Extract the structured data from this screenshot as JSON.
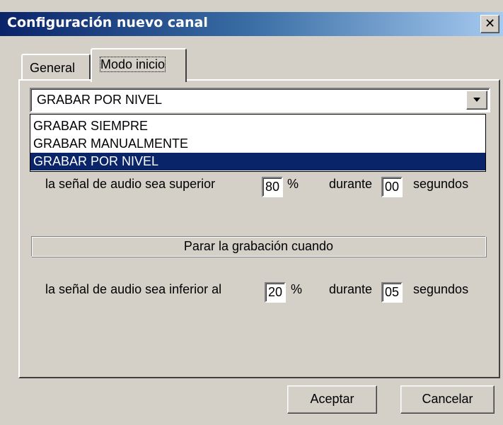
{
  "window": {
    "title": "Configuración nuevo canal",
    "close_glyph": "✕"
  },
  "tabs": [
    {
      "label": "General",
      "active": false
    },
    {
      "label": "Modo inicio",
      "active": true
    }
  ],
  "mode_select": {
    "value": "GRABAR POR NIVEL",
    "options": [
      "GRABAR SIEMPRE",
      "GRABAR MANUALMENTE",
      "GRABAR POR NIVEL"
    ],
    "selected_index": 2
  },
  "start_row": {
    "text": "la señal de audio sea superior",
    "percent": "80",
    "percent_sign": "%",
    "during_label": "durante",
    "seconds": "00",
    "seconds_label": "segundos"
  },
  "stop_section": {
    "header": "Parar la grabación cuando"
  },
  "stop_row": {
    "text": "la señal de audio sea inferior al",
    "percent": "20",
    "percent_sign": "%",
    "during_label": "durante",
    "seconds": "05",
    "seconds_label": "segundos"
  },
  "buttons": {
    "ok": "Aceptar",
    "cancel": "Cancelar"
  },
  "colors": {
    "face": "#d4d0c8",
    "title_start": "#0a246a",
    "title_end": "#a6caf0",
    "selection": "#0a246a"
  },
  "icons": {
    "close": "close-icon",
    "dropdown": "chevron-down-icon"
  }
}
